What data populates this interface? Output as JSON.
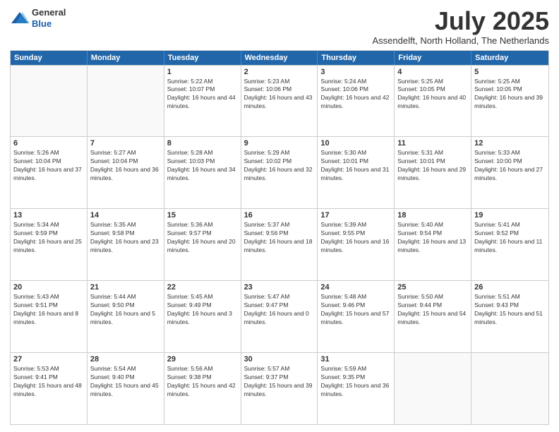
{
  "header": {
    "logo": {
      "general": "General",
      "blue": "Blue"
    },
    "title": "July 2025",
    "subtitle": "Assendelft, North Holland, The Netherlands"
  },
  "calendar": {
    "days": [
      "Sunday",
      "Monday",
      "Tuesday",
      "Wednesday",
      "Thursday",
      "Friday",
      "Saturday"
    ],
    "weeks": [
      [
        {
          "day": "",
          "empty": true
        },
        {
          "day": "",
          "empty": true
        },
        {
          "day": "1",
          "sunrise": "Sunrise: 5:22 AM",
          "sunset": "Sunset: 10:07 PM",
          "daylight": "Daylight: 16 hours and 44 minutes."
        },
        {
          "day": "2",
          "sunrise": "Sunrise: 5:23 AM",
          "sunset": "Sunset: 10:06 PM",
          "daylight": "Daylight: 16 hours and 43 minutes."
        },
        {
          "day": "3",
          "sunrise": "Sunrise: 5:24 AM",
          "sunset": "Sunset: 10:06 PM",
          "daylight": "Daylight: 16 hours and 42 minutes."
        },
        {
          "day": "4",
          "sunrise": "Sunrise: 5:25 AM",
          "sunset": "Sunset: 10:05 PM",
          "daylight": "Daylight: 16 hours and 40 minutes."
        },
        {
          "day": "5",
          "sunrise": "Sunrise: 5:25 AM",
          "sunset": "Sunset: 10:05 PM",
          "daylight": "Daylight: 16 hours and 39 minutes."
        }
      ],
      [
        {
          "day": "6",
          "sunrise": "Sunrise: 5:26 AM",
          "sunset": "Sunset: 10:04 PM",
          "daylight": "Daylight: 16 hours and 37 minutes."
        },
        {
          "day": "7",
          "sunrise": "Sunrise: 5:27 AM",
          "sunset": "Sunset: 10:04 PM",
          "daylight": "Daylight: 16 hours and 36 minutes."
        },
        {
          "day": "8",
          "sunrise": "Sunrise: 5:28 AM",
          "sunset": "Sunset: 10:03 PM",
          "daylight": "Daylight: 16 hours and 34 minutes."
        },
        {
          "day": "9",
          "sunrise": "Sunrise: 5:29 AM",
          "sunset": "Sunset: 10:02 PM",
          "daylight": "Daylight: 16 hours and 32 minutes."
        },
        {
          "day": "10",
          "sunrise": "Sunrise: 5:30 AM",
          "sunset": "Sunset: 10:01 PM",
          "daylight": "Daylight: 16 hours and 31 minutes."
        },
        {
          "day": "11",
          "sunrise": "Sunrise: 5:31 AM",
          "sunset": "Sunset: 10:01 PM",
          "daylight": "Daylight: 16 hours and 29 minutes."
        },
        {
          "day": "12",
          "sunrise": "Sunrise: 5:33 AM",
          "sunset": "Sunset: 10:00 PM",
          "daylight": "Daylight: 16 hours and 27 minutes."
        }
      ],
      [
        {
          "day": "13",
          "sunrise": "Sunrise: 5:34 AM",
          "sunset": "Sunset: 9:59 PM",
          "daylight": "Daylight: 16 hours and 25 minutes."
        },
        {
          "day": "14",
          "sunrise": "Sunrise: 5:35 AM",
          "sunset": "Sunset: 9:58 PM",
          "daylight": "Daylight: 16 hours and 23 minutes."
        },
        {
          "day": "15",
          "sunrise": "Sunrise: 5:36 AM",
          "sunset": "Sunset: 9:57 PM",
          "daylight": "Daylight: 16 hours and 20 minutes."
        },
        {
          "day": "16",
          "sunrise": "Sunrise: 5:37 AM",
          "sunset": "Sunset: 9:56 PM",
          "daylight": "Daylight: 16 hours and 18 minutes."
        },
        {
          "day": "17",
          "sunrise": "Sunrise: 5:39 AM",
          "sunset": "Sunset: 9:55 PM",
          "daylight": "Daylight: 16 hours and 16 minutes."
        },
        {
          "day": "18",
          "sunrise": "Sunrise: 5:40 AM",
          "sunset": "Sunset: 9:54 PM",
          "daylight": "Daylight: 16 hours and 13 minutes."
        },
        {
          "day": "19",
          "sunrise": "Sunrise: 5:41 AM",
          "sunset": "Sunset: 9:52 PM",
          "daylight": "Daylight: 16 hours and 11 minutes."
        }
      ],
      [
        {
          "day": "20",
          "sunrise": "Sunrise: 5:43 AM",
          "sunset": "Sunset: 9:51 PM",
          "daylight": "Daylight: 16 hours and 8 minutes."
        },
        {
          "day": "21",
          "sunrise": "Sunrise: 5:44 AM",
          "sunset": "Sunset: 9:50 PM",
          "daylight": "Daylight: 16 hours and 5 minutes."
        },
        {
          "day": "22",
          "sunrise": "Sunrise: 5:45 AM",
          "sunset": "Sunset: 9:49 PM",
          "daylight": "Daylight: 16 hours and 3 minutes."
        },
        {
          "day": "23",
          "sunrise": "Sunrise: 5:47 AM",
          "sunset": "Sunset: 9:47 PM",
          "daylight": "Daylight: 16 hours and 0 minutes."
        },
        {
          "day": "24",
          "sunrise": "Sunrise: 5:48 AM",
          "sunset": "Sunset: 9:46 PM",
          "daylight": "Daylight: 15 hours and 57 minutes."
        },
        {
          "day": "25",
          "sunrise": "Sunrise: 5:50 AM",
          "sunset": "Sunset: 9:44 PM",
          "daylight": "Daylight: 15 hours and 54 minutes."
        },
        {
          "day": "26",
          "sunrise": "Sunrise: 5:51 AM",
          "sunset": "Sunset: 9:43 PM",
          "daylight": "Daylight: 15 hours and 51 minutes."
        }
      ],
      [
        {
          "day": "27",
          "sunrise": "Sunrise: 5:53 AM",
          "sunset": "Sunset: 9:41 PM",
          "daylight": "Daylight: 15 hours and 48 minutes."
        },
        {
          "day": "28",
          "sunrise": "Sunrise: 5:54 AM",
          "sunset": "Sunset: 9:40 PM",
          "daylight": "Daylight: 15 hours and 45 minutes."
        },
        {
          "day": "29",
          "sunrise": "Sunrise: 5:56 AM",
          "sunset": "Sunset: 9:38 PM",
          "daylight": "Daylight: 15 hours and 42 minutes."
        },
        {
          "day": "30",
          "sunrise": "Sunrise: 5:57 AM",
          "sunset": "Sunset: 9:37 PM",
          "daylight": "Daylight: 15 hours and 39 minutes."
        },
        {
          "day": "31",
          "sunrise": "Sunrise: 5:59 AM",
          "sunset": "Sunset: 9:35 PM",
          "daylight": "Daylight: 15 hours and 36 minutes."
        },
        {
          "day": "",
          "empty": true
        },
        {
          "day": "",
          "empty": true
        }
      ]
    ]
  }
}
